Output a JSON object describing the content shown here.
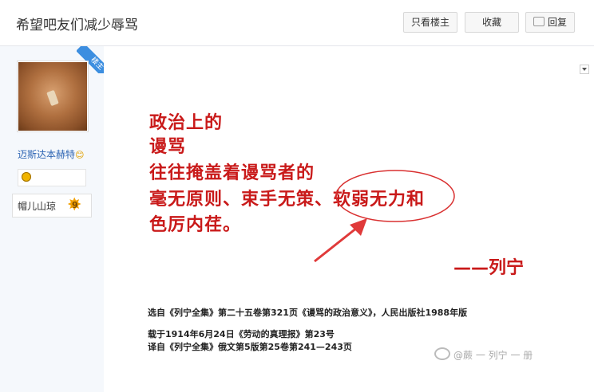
{
  "header": {
    "title": "希望吧友们减少辱骂",
    "only_host": "只看楼主",
    "favorite": "收藏",
    "reply": "回复"
  },
  "author": {
    "ribbon": "楼主",
    "name": "迈斯达本赫特",
    "name_emoji": "😊",
    "level_name": "帽儿山琼",
    "level": "9"
  },
  "post_image": {
    "lines": [
      "政治上的",
      "谩骂",
      "往往掩盖着谩骂者的",
      "毫无原则、束手无策、软弱无力和",
      "色厉内荏。"
    ],
    "attribution": "——列宁",
    "source1": "选自《列宁全集》第二十五卷第321页《谩骂的政治意义》，人民出版社1988年版",
    "source2": "载于1914年6月24日《劳动的真理报》第23号",
    "source3": "译自《列宁全集》俄文第5版第25卷第241—243页",
    "watermark": "@蕨 一 列宁 一 册"
  },
  "colors": {
    "accent": "#3c8ee0",
    "highlight_red": "#c91a1a"
  }
}
